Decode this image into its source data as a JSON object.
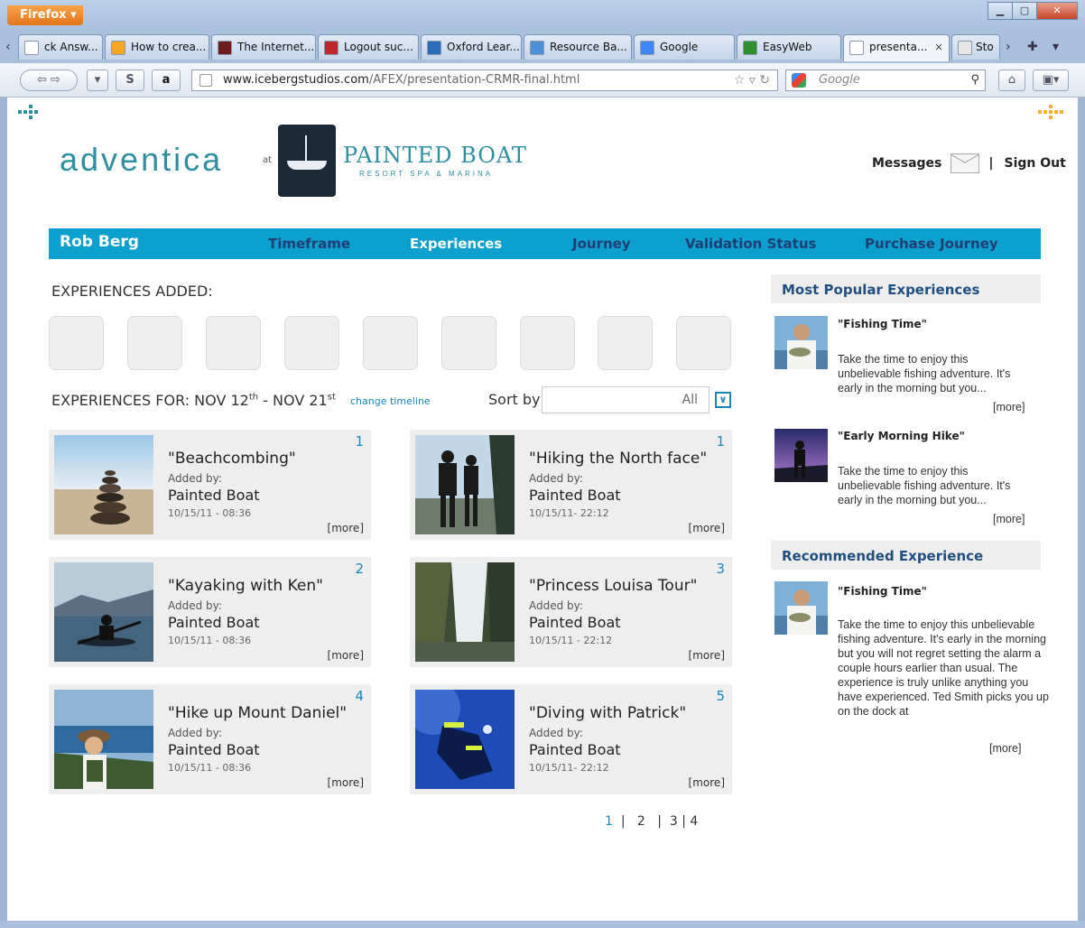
{
  "browser": {
    "menu_label": "Firefox",
    "tabs": [
      {
        "label": "ck Answ...",
        "color": "#ffffff"
      },
      {
        "label": "How to crea...",
        "color": "#f5a623"
      },
      {
        "label": "The Internet...",
        "color": "#6b1d1d"
      },
      {
        "label": "Logout suc...",
        "color": "#c0272d"
      },
      {
        "label": "Oxford Lear...",
        "color": "#2a6ebb"
      },
      {
        "label": "Resource Ba...",
        "color": "#4c8fd6"
      },
      {
        "label": "Google",
        "color": "#4285f4"
      },
      {
        "label": "EasyWeb",
        "color": "#2f8f2f"
      },
      {
        "label": "presenta...",
        "color": "#ffffff"
      },
      {
        "label": "Sto",
        "color": "#e6e6e6"
      }
    ],
    "url_domain": "www.icebergstudios.com",
    "url_path": "/AFEX/presentation-CRMR-final.html",
    "search_placeholder": "Google",
    "tab_close": "×",
    "amazon_label": "a",
    "s_label": "S"
  },
  "header": {
    "logo_text": "adventica",
    "logo_at": "at",
    "brand_name": "PAINTED BOAT",
    "brand_sub": "RESORT SPA & MARINA",
    "messages_label": "Messages",
    "separator": "|",
    "signout_label": "Sign Out"
  },
  "nav": {
    "user": "Rob Berg",
    "items": [
      "Timeframe",
      "Experiences",
      "Journey",
      "Validation Status",
      "Purchase Journey"
    ]
  },
  "added": {
    "title": "EXPERIENCES ADDED:",
    "slot_count": 9
  },
  "filter": {
    "prefix": "EXPERIENCES FOR: NOV 12",
    "sup1": "th",
    "middle": " - NOV 21",
    "sup2": "st",
    "change_label": "change timeline",
    "sortby_label": "Sort by",
    "sort_value": "All"
  },
  "cards": [
    {
      "num": "1",
      "title": "\"Beachcombing\"",
      "added_by": "Added by:",
      "org": "Painted Boat",
      "date": "10/15/11 - 08:36",
      "more": "[more]",
      "thumb": "beach"
    },
    {
      "num": "1",
      "title": "\"Hiking the North face\"",
      "added_by": "Added by:",
      "org": "Painted Boat",
      "date": "10/15/11- 22:12",
      "more": "[more]",
      "thumb": "hikers"
    },
    {
      "num": "2",
      "title": "\"Kayaking with Ken\"",
      "added_by": "Added by:",
      "org": "Painted Boat",
      "date": "10/15/11 - 08:36",
      "more": "[more]",
      "thumb": "kayak"
    },
    {
      "num": "3",
      "title": "\"Princess Louisa Tour\"",
      "added_by": "Added by:",
      "org": "Painted Boat",
      "date": "10/15/11 - 22:12",
      "more": "[more]",
      "thumb": "waterfall"
    },
    {
      "num": "4",
      "title": "\"Hike up Mount Daniel\"",
      "added_by": "Added by:",
      "org": "Painted Boat",
      "date": "10/15/11 - 08:36",
      "more": "[more]",
      "thumb": "mountain"
    },
    {
      "num": "5",
      "title": "\"Diving with Patrick\"",
      "added_by": "Added by:",
      "org": "Painted Boat",
      "date": "10/15/11- 22:12",
      "more": "[more]",
      "thumb": "diver"
    }
  ],
  "pager": {
    "p1": "1",
    "sep": "|",
    "p2": "2",
    "p3": "3",
    "p4": "4"
  },
  "sidebar": {
    "popular_title": "Most Popular Experiences",
    "popular": [
      {
        "title": "\"Fishing Time\"",
        "desc": "Take the time to enjoy this unbelievable fishing adventure. It's early in the morning but you...",
        "more": "[more]"
      },
      {
        "title": "\"Early Morning Hike\"",
        "desc": "Take the time to enjoy this unbelievable fishing adventure. It's early in the morning but you...",
        "more": "[more]"
      }
    ],
    "recommended_title": "Recommended Experience",
    "recommended": {
      "title": "\"Fishing Time\"",
      "desc": "Take the time to enjoy this unbelievable fishing adventure. It's early in the morning but you will not regret setting the alarm a couple hours earlier than usual. The experience is truly unlike anything you have experienced. Ted Smith picks you up on the dock at",
      "more": "[more]"
    }
  },
  "colors": {
    "nav_bg": "#0ca0cf",
    "nav_text": "#1f3f74",
    "accent": "#1a86b9",
    "logo": "#2f8fa0"
  }
}
